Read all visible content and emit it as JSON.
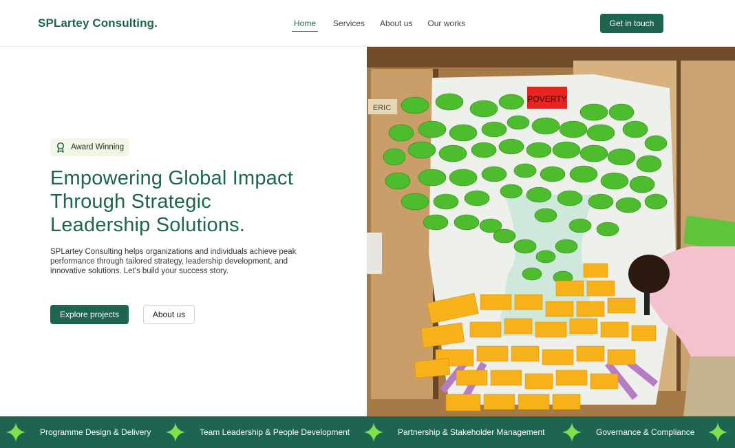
{
  "header": {
    "brand": "SPLartey Consulting.",
    "nav": [
      {
        "label": "Home",
        "active": true
      },
      {
        "label": "Services",
        "active": false
      },
      {
        "label": "About us",
        "active": false
      },
      {
        "label": "Our works",
        "active": false
      }
    ],
    "cta_label": "Get in touch"
  },
  "hero": {
    "badge_label": "Award Winning",
    "badge_icon": "award-ribbon-icon",
    "title_lines": [
      "Empowering Global Impact",
      "Through Strategic",
      "Leadership Solutions."
    ],
    "description_lines": [
      "SPLartey Consulting helps organizations and individuals achieve peak",
      "performance through tailored strategy, leadership development, and",
      "innovative solutions. Let's build your success story."
    ],
    "primary_button": "Explore projects",
    "secondary_button": "About us",
    "image_sign_text": "POVERTY",
    "image_name_tag": "ERIC"
  },
  "ticker": {
    "items": [
      "Programme Design & Delivery",
      "Team Leadership & People Development",
      "Partnership & Stakeholder Management",
      "Governance & Compliance"
    ],
    "separator_icon": "four-point-star-icon"
  },
  "colors": {
    "brand_green": "#1d6451",
    "star_green": "#7ee04a",
    "badge_bg": "#f1f7e5"
  }
}
